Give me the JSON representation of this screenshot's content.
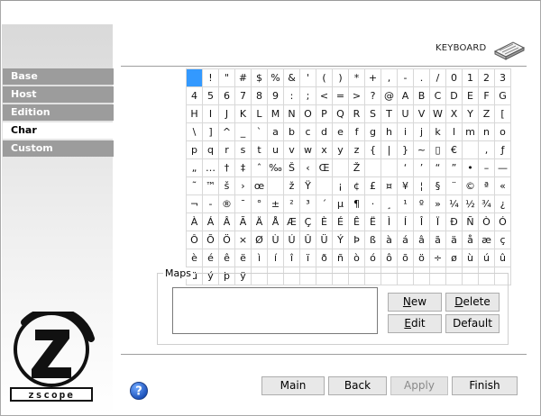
{
  "sidebar": {
    "items": [
      {
        "label": "Base",
        "active": false
      },
      {
        "label": "Host",
        "active": false
      },
      {
        "label": "Edition",
        "active": false
      },
      {
        "label": "Char",
        "active": true
      },
      {
        "label": "Custom",
        "active": false
      }
    ],
    "logo_text": "zscope"
  },
  "header": {
    "label": "KEYBOARD",
    "icon": "keyboard-icon"
  },
  "char_grid": {
    "selected": [
      0,
      0
    ],
    "rows": [
      [
        "",
        "!",
        "\"",
        "#",
        "$",
        "%",
        "&",
        "'",
        "(",
        ")",
        "*",
        "+",
        ",",
        "-",
        ".",
        "/",
        "0",
        "1",
        "2",
        "3"
      ],
      [
        "4",
        "5",
        "6",
        "7",
        "8",
        "9",
        ":",
        ";",
        "<",
        "=",
        ">",
        "?",
        "@",
        "A",
        "B",
        "C",
        "D",
        "E",
        "F",
        "G"
      ],
      [
        "H",
        "I",
        "J",
        "K",
        "L",
        "M",
        "N",
        "O",
        "P",
        "Q",
        "R",
        "S",
        "T",
        "U",
        "V",
        "W",
        "X",
        "Y",
        "Z",
        "["
      ],
      [
        "\\",
        "]",
        "^",
        "_",
        "`",
        "a",
        "b",
        "c",
        "d",
        "e",
        "f",
        "g",
        "h",
        "i",
        "j",
        "k",
        "l",
        "m",
        "n",
        "o"
      ],
      [
        "p",
        "q",
        "r",
        "s",
        "t",
        "u",
        "v",
        "w",
        "x",
        "y",
        "z",
        "{",
        "|",
        "}",
        "~",
        "▯",
        "€",
        "",
        ",",
        "ƒ"
      ],
      [
        "„",
        "…",
        "†",
        "‡",
        "ˆ",
        "‰",
        "Š",
        "‹",
        "Œ",
        "",
        "Ž",
        "",
        "",
        "‘",
        "’",
        "“",
        "”",
        "•",
        "–",
        "—"
      ],
      [
        "˜",
        "™",
        "š",
        "›",
        "œ",
        "",
        "ž",
        "Ÿ",
        "",
        "¡",
        "¢",
        "£",
        "¤",
        "¥",
        "¦",
        "§",
        "¨",
        "©",
        "ª",
        "«"
      ],
      [
        "¬",
        "-",
        "®",
        "¯",
        "°",
        "±",
        "²",
        "³",
        "´",
        "µ",
        "¶",
        "·",
        "¸",
        "¹",
        "º",
        "»",
        "¼",
        "½",
        "¾",
        "¿"
      ],
      [
        "À",
        "Á",
        "Â",
        "Ã",
        "Ä",
        "Å",
        "Æ",
        "Ç",
        "È",
        "É",
        "Ê",
        "Ë",
        "Ì",
        "Í",
        "Î",
        "Ï",
        "Ð",
        "Ñ",
        "Ò",
        "Ó"
      ],
      [
        "Ô",
        "Õ",
        "Ö",
        "×",
        "Ø",
        "Ù",
        "Ú",
        "Û",
        "Ü",
        "Ý",
        "Þ",
        "ß",
        "à",
        "á",
        "â",
        "ã",
        "ä",
        "å",
        "æ",
        "ç"
      ],
      [
        "è",
        "é",
        "ê",
        "ë",
        "ì",
        "í",
        "î",
        "ï",
        "ð",
        "ñ",
        "ò",
        "ó",
        "ô",
        "õ",
        "ö",
        "÷",
        "ø",
        "ù",
        "ú",
        "û"
      ],
      [
        "ü",
        "ý",
        "þ",
        "ÿ",
        "",
        "",
        "",
        "",
        "",
        "",
        "",
        "",
        "",
        "",
        "",
        "",
        "",
        "",
        "",
        ""
      ]
    ]
  },
  "maps": {
    "legend": "Maps",
    "items": [],
    "buttons": {
      "new": {
        "pre": "",
        "key": "N",
        "post": "ew"
      },
      "delete": {
        "pre": "",
        "key": "D",
        "post": "elete"
      },
      "edit": {
        "pre": "",
        "key": "E",
        "post": "dit"
      },
      "default": {
        "pre": "Default",
        "key": "",
        "post": ""
      }
    }
  },
  "footer": {
    "help_icon": "help-icon",
    "main_label": "Main",
    "back_label": "Back",
    "apply_label": "Apply",
    "finish_label": "Finish"
  },
  "colors": {
    "selected_cell": "#3399ff",
    "nav_inactive": "#9c9c9c"
  }
}
